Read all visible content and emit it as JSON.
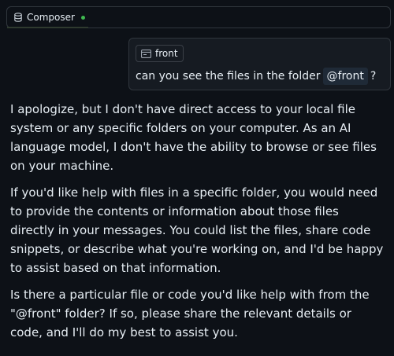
{
  "tab": {
    "label": "Composer",
    "icon": "database-icon",
    "status_color": "#3fb950"
  },
  "user_message": {
    "context_chip": {
      "label": "front",
      "icon": "folder-icon"
    },
    "text_before": "can you see the files in the folder",
    "mention": "@front",
    "text_after": "?"
  },
  "assistant_message": {
    "paragraphs": [
      "I apologize, but I don't have direct access to your local file system or any specific folders on your computer. As an AI language model, I don't have the ability to browse or see files on your machine.",
      "If you'd like help with files in a specific folder, you would need to provide the contents or information about those files directly in your messages. You could list the files, share code snippets, or describe what you're working on, and I'd be happy to assist based on that information.",
      "Is there a particular file or code you'd like help with from the \"@front\" folder? If so, please share the relevant details or code, and I'll do my best to assist you."
    ]
  }
}
